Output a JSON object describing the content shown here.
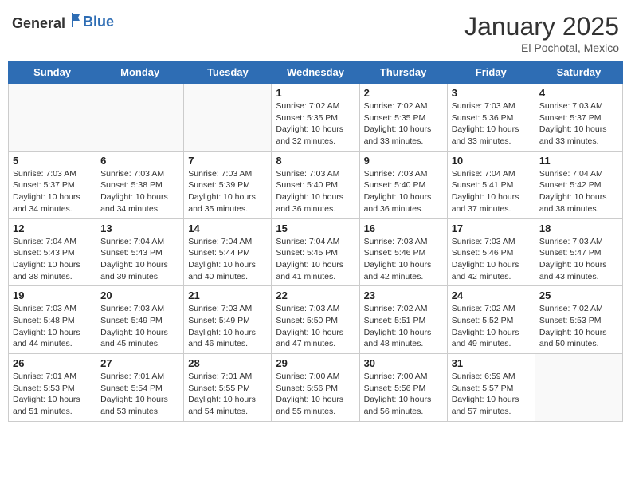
{
  "logo": {
    "general": "General",
    "blue": "Blue"
  },
  "header": {
    "title": "January 2025",
    "subtitle": "El Pochotal, Mexico"
  },
  "weekdays": [
    "Sunday",
    "Monday",
    "Tuesday",
    "Wednesday",
    "Thursday",
    "Friday",
    "Saturday"
  ],
  "weeks": [
    [
      {
        "day": "",
        "sunrise": "",
        "sunset": "",
        "daylight": "",
        "empty": true
      },
      {
        "day": "",
        "sunrise": "",
        "sunset": "",
        "daylight": "",
        "empty": true
      },
      {
        "day": "",
        "sunrise": "",
        "sunset": "",
        "daylight": "",
        "empty": true
      },
      {
        "day": "1",
        "sunrise": "Sunrise: 7:02 AM",
        "sunset": "Sunset: 5:35 PM",
        "daylight": "Daylight: 10 hours and 32 minutes."
      },
      {
        "day": "2",
        "sunrise": "Sunrise: 7:02 AM",
        "sunset": "Sunset: 5:35 PM",
        "daylight": "Daylight: 10 hours and 33 minutes."
      },
      {
        "day": "3",
        "sunrise": "Sunrise: 7:03 AM",
        "sunset": "Sunset: 5:36 PM",
        "daylight": "Daylight: 10 hours and 33 minutes."
      },
      {
        "day": "4",
        "sunrise": "Sunrise: 7:03 AM",
        "sunset": "Sunset: 5:37 PM",
        "daylight": "Daylight: 10 hours and 33 minutes."
      }
    ],
    [
      {
        "day": "5",
        "sunrise": "Sunrise: 7:03 AM",
        "sunset": "Sunset: 5:37 PM",
        "daylight": "Daylight: 10 hours and 34 minutes."
      },
      {
        "day": "6",
        "sunrise": "Sunrise: 7:03 AM",
        "sunset": "Sunset: 5:38 PM",
        "daylight": "Daylight: 10 hours and 34 minutes."
      },
      {
        "day": "7",
        "sunrise": "Sunrise: 7:03 AM",
        "sunset": "Sunset: 5:39 PM",
        "daylight": "Daylight: 10 hours and 35 minutes."
      },
      {
        "day": "8",
        "sunrise": "Sunrise: 7:03 AM",
        "sunset": "Sunset: 5:40 PM",
        "daylight": "Daylight: 10 hours and 36 minutes."
      },
      {
        "day": "9",
        "sunrise": "Sunrise: 7:03 AM",
        "sunset": "Sunset: 5:40 PM",
        "daylight": "Daylight: 10 hours and 36 minutes."
      },
      {
        "day": "10",
        "sunrise": "Sunrise: 7:04 AM",
        "sunset": "Sunset: 5:41 PM",
        "daylight": "Daylight: 10 hours and 37 minutes."
      },
      {
        "day": "11",
        "sunrise": "Sunrise: 7:04 AM",
        "sunset": "Sunset: 5:42 PM",
        "daylight": "Daylight: 10 hours and 38 minutes."
      }
    ],
    [
      {
        "day": "12",
        "sunrise": "Sunrise: 7:04 AM",
        "sunset": "Sunset: 5:43 PM",
        "daylight": "Daylight: 10 hours and 38 minutes."
      },
      {
        "day": "13",
        "sunrise": "Sunrise: 7:04 AM",
        "sunset": "Sunset: 5:43 PM",
        "daylight": "Daylight: 10 hours and 39 minutes."
      },
      {
        "day": "14",
        "sunrise": "Sunrise: 7:04 AM",
        "sunset": "Sunset: 5:44 PM",
        "daylight": "Daylight: 10 hours and 40 minutes."
      },
      {
        "day": "15",
        "sunrise": "Sunrise: 7:04 AM",
        "sunset": "Sunset: 5:45 PM",
        "daylight": "Daylight: 10 hours and 41 minutes."
      },
      {
        "day": "16",
        "sunrise": "Sunrise: 7:03 AM",
        "sunset": "Sunset: 5:46 PM",
        "daylight": "Daylight: 10 hours and 42 minutes."
      },
      {
        "day": "17",
        "sunrise": "Sunrise: 7:03 AM",
        "sunset": "Sunset: 5:46 PM",
        "daylight": "Daylight: 10 hours and 42 minutes."
      },
      {
        "day": "18",
        "sunrise": "Sunrise: 7:03 AM",
        "sunset": "Sunset: 5:47 PM",
        "daylight": "Daylight: 10 hours and 43 minutes."
      }
    ],
    [
      {
        "day": "19",
        "sunrise": "Sunrise: 7:03 AM",
        "sunset": "Sunset: 5:48 PM",
        "daylight": "Daylight: 10 hours and 44 minutes."
      },
      {
        "day": "20",
        "sunrise": "Sunrise: 7:03 AM",
        "sunset": "Sunset: 5:49 PM",
        "daylight": "Daylight: 10 hours and 45 minutes."
      },
      {
        "day": "21",
        "sunrise": "Sunrise: 7:03 AM",
        "sunset": "Sunset: 5:49 PM",
        "daylight": "Daylight: 10 hours and 46 minutes."
      },
      {
        "day": "22",
        "sunrise": "Sunrise: 7:03 AM",
        "sunset": "Sunset: 5:50 PM",
        "daylight": "Daylight: 10 hours and 47 minutes."
      },
      {
        "day": "23",
        "sunrise": "Sunrise: 7:02 AM",
        "sunset": "Sunset: 5:51 PM",
        "daylight": "Daylight: 10 hours and 48 minutes."
      },
      {
        "day": "24",
        "sunrise": "Sunrise: 7:02 AM",
        "sunset": "Sunset: 5:52 PM",
        "daylight": "Daylight: 10 hours and 49 minutes."
      },
      {
        "day": "25",
        "sunrise": "Sunrise: 7:02 AM",
        "sunset": "Sunset: 5:53 PM",
        "daylight": "Daylight: 10 hours and 50 minutes."
      }
    ],
    [
      {
        "day": "26",
        "sunrise": "Sunrise: 7:01 AM",
        "sunset": "Sunset: 5:53 PM",
        "daylight": "Daylight: 10 hours and 51 minutes."
      },
      {
        "day": "27",
        "sunrise": "Sunrise: 7:01 AM",
        "sunset": "Sunset: 5:54 PM",
        "daylight": "Daylight: 10 hours and 53 minutes."
      },
      {
        "day": "28",
        "sunrise": "Sunrise: 7:01 AM",
        "sunset": "Sunset: 5:55 PM",
        "daylight": "Daylight: 10 hours and 54 minutes."
      },
      {
        "day": "29",
        "sunrise": "Sunrise: 7:00 AM",
        "sunset": "Sunset: 5:56 PM",
        "daylight": "Daylight: 10 hours and 55 minutes."
      },
      {
        "day": "30",
        "sunrise": "Sunrise: 7:00 AM",
        "sunset": "Sunset: 5:56 PM",
        "daylight": "Daylight: 10 hours and 56 minutes."
      },
      {
        "day": "31",
        "sunrise": "Sunrise: 6:59 AM",
        "sunset": "Sunset: 5:57 PM",
        "daylight": "Daylight: 10 hours and 57 minutes."
      },
      {
        "day": "",
        "sunrise": "",
        "sunset": "",
        "daylight": "",
        "empty": true
      }
    ]
  ]
}
